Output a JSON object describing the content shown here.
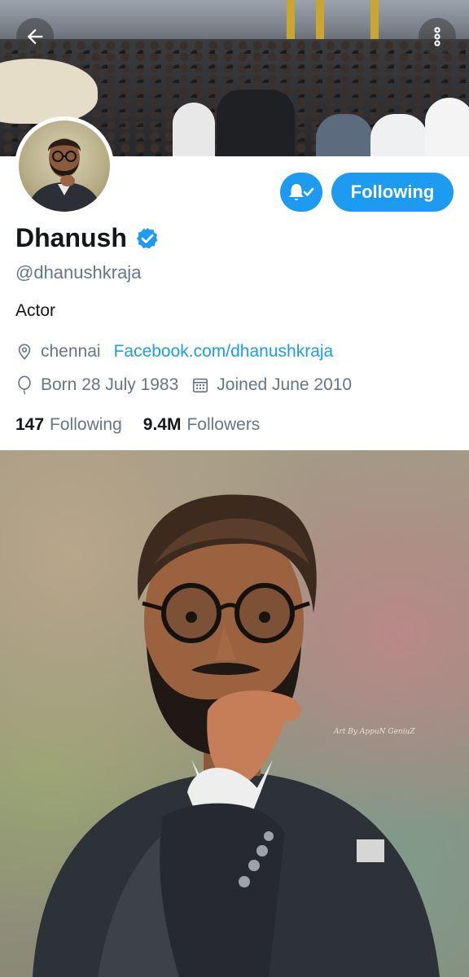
{
  "header": {
    "back_icon": "arrow-left-icon",
    "more_icon": "more-vertical-icon"
  },
  "profile": {
    "name": "Dhanush",
    "verified": true,
    "handle": "@dhanushkraja",
    "bio": "Actor",
    "location": "chennai",
    "website": "Facebook.com/dhanushkraja",
    "birthday": "Born 28 July 1983",
    "joined": "Joined June 2010",
    "following_count": "147",
    "following_label": "Following",
    "followers_count": "9.4M",
    "followers_label": "Followers"
  },
  "actions": {
    "notifications_icon": "bell-check-icon",
    "follow_label": "Following"
  },
  "artwork": {
    "signature": "Art By AppuN GeniuZ"
  },
  "colors": {
    "accent": "#1d9bf0",
    "secondary_text": "#657786",
    "primary_text": "#14171a"
  }
}
